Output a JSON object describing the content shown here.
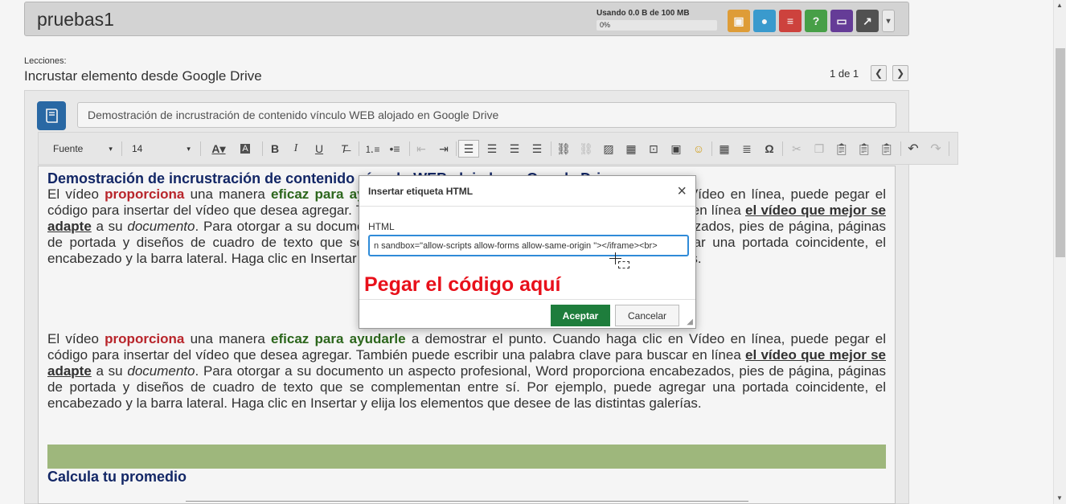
{
  "header": {
    "project_title": "pruebas1",
    "usage_label": "Usando 0.0 B de 100 MB",
    "usage_percent_text": "0%",
    "usage_fraction": 0,
    "buttons": [
      {
        "name": "briefcase-icon",
        "color": "#e8a33a",
        "glyph": "▣"
      },
      {
        "name": "chat-icon",
        "color": "#3da1d6",
        "glyph": "●"
      },
      {
        "name": "cards-icon",
        "color": "#d64540",
        "glyph": "≡"
      },
      {
        "name": "help-icon",
        "color": "#4aa64a",
        "glyph": "?"
      },
      {
        "name": "laptop-icon",
        "color": "#6a3f9e",
        "glyph": "▭"
      },
      {
        "name": "chart-icon",
        "color": "#555555",
        "glyph": "↗"
      }
    ],
    "dropdown_glyph": "▾"
  },
  "lessons": {
    "label": "Lecciones:",
    "title": "Incrustar elemento desde Google Drive",
    "pager_text": "1 de 1",
    "prev_glyph": "❮",
    "next_glyph": "❯"
  },
  "editor": {
    "description_value": "Demostración de incrustración de contenido vínculo WEB alojado en Google Drive",
    "toolbar": {
      "font_select": "Fuente",
      "size_select": "14"
    }
  },
  "document": {
    "heading": "Demostración de incrustración de contenido vínculo WEB alojado en Google Drive",
    "paragraph": {
      "t1": "El vídeo ",
      "red": "proporciona",
      "t2": " una manera ",
      "green": "eficaz para ayudarle",
      "t3": " a demostrar el punto. Cuando haga clic en Vídeo en línea, puede pegar el código para insertar del vídeo que desea agregar. También puede escribir una palabra clave para buscar en línea ",
      "link": "el vídeo que mejor se adapte",
      "t4": " a su ",
      "italic": "documento",
      "t5": ". Para otorgar a su documento un aspecto profesional, Word proporciona encabezados, pies de página, páginas de portada y diseños de cuadro de texto que se complementan entre sí. Por ejemplo, puede agregar una portada coincidente, el encabezado y la barra lateral. Haga clic en Insertar y elija los elementos que desee de las distintas galerías."
    },
    "section_heading": "Calcula tu promedio"
  },
  "dialog": {
    "title": "Insertar etiqueta HTML",
    "close_glyph": "×",
    "field_label": "HTML",
    "field_value": "n sandbox=\"allow-scripts allow-forms allow-same-origin \"></iframe><br>",
    "hint": "Pegar el código aquí",
    "accept_label": "Aceptar",
    "cancel_label": "Cancelar"
  }
}
